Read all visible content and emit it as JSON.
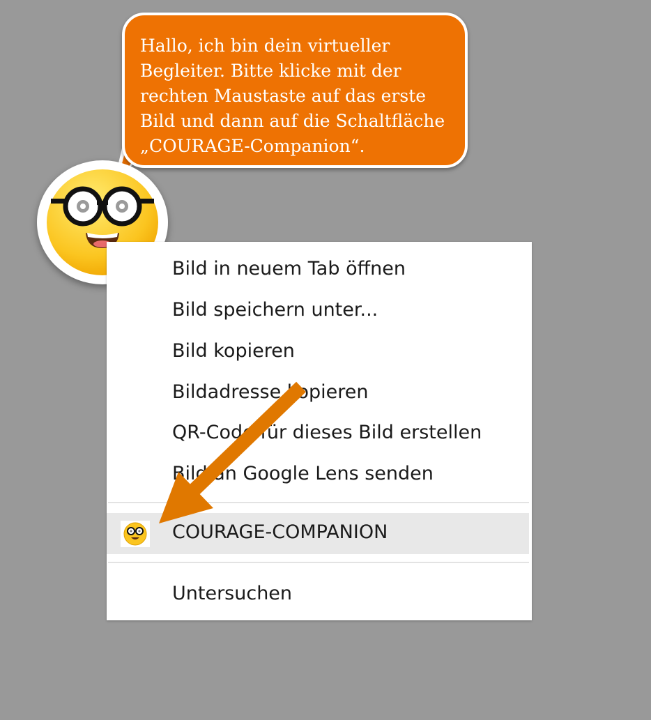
{
  "bubble": {
    "text": "Hallo, ich bin dein virtueller\nBegleiter. Bitte klicke mit der\nrechten Maustaste auf das erste\nBild und dann auf die Schaltfläche\n„COURAGE-Companion“."
  },
  "avatar": {
    "icon": "nerd-glasses-emoji-icon"
  },
  "menu": {
    "items": [
      {
        "label": "Bild in neuem Tab öffnen"
      },
      {
        "label": "Bild speichern unter..."
      },
      {
        "label": "Bild kopieren"
      },
      {
        "label": "Bildadresse kopieren"
      },
      {
        "label": "QR-Code für dieses Bild erstellen"
      },
      {
        "label": "Bild an Google Lens senden"
      }
    ],
    "companion": {
      "label": "COURAGE-COMPANION",
      "icon": "nerd-glasses-emoji-icon"
    },
    "inspect": {
      "label": "Untersuchen"
    }
  },
  "colors": {
    "background": "#999999",
    "accent_orange": "#ee7203",
    "menu_highlight": "#e8e8e8"
  }
}
